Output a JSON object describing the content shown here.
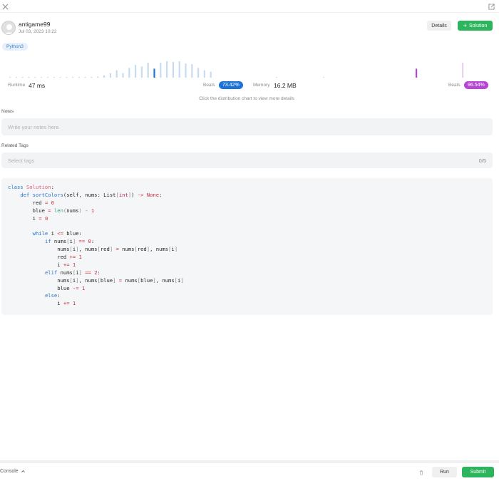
{
  "header": {
    "close_icon": "close-icon",
    "open_external_icon": "open-external-icon"
  },
  "submission": {
    "username": "antigame99",
    "date": "Jul 03, 2023 10:22",
    "details_label": "Details",
    "solution_label": "Solution",
    "language": "Python3"
  },
  "stats": {
    "runtime_label": "Runtime",
    "runtime_value": "47 ms",
    "runtime_beats_label": "Beats",
    "runtime_beats_value": "73.42%",
    "memory_label": "Memory",
    "memory_value": "16.2 MB",
    "memory_beats_label": "Beats",
    "memory_beats_value": "96.54%",
    "hint": "Click the distribution chart to view more details"
  },
  "chart_data": {
    "type": "bar",
    "runtime_distribution": [
      1,
      1,
      1,
      1,
      1,
      1,
      1,
      1,
      1,
      1,
      1,
      1,
      1,
      1,
      1.5,
      3,
      6,
      10,
      6,
      13,
      17,
      15,
      20,
      12,
      20,
      22,
      21,
      22,
      19,
      18,
      13,
      10,
      8
    ],
    "runtime_highlight_index": 23,
    "memory_distribution": [
      1,
      1,
      12,
      20
    ],
    "memory_highlight_index": 2,
    "colors": {
      "runtime_bar": "#c7dcf2",
      "runtime_highlight": "#1d74d6",
      "memory_bar": "#e8d3f3",
      "memory_highlight": "#b646d3"
    }
  },
  "notes": {
    "label": "Notes",
    "placeholder": "Write your notes here"
  },
  "tags": {
    "label": "Related Tags",
    "placeholder": "Select tags",
    "count": "0/5"
  },
  "code": {
    "lines": [
      [
        [
          "kw",
          "class"
        ],
        [
          "t",
          " "
        ],
        [
          "cls",
          "Solution"
        ],
        [
          "t",
          ":"
        ]
      ],
      [
        [
          "t",
          "    "
        ],
        [
          "kw",
          "def"
        ],
        [
          "t",
          " "
        ],
        [
          "fn",
          "sortColors"
        ],
        [
          "t",
          "("
        ],
        [
          "t",
          "self"
        ],
        [
          "t",
          ", nums: "
        ],
        [
          "t",
          "List"
        ],
        [
          "pr",
          "["
        ],
        [
          "ty",
          "int"
        ],
        [
          "pr",
          "]"
        ],
        [
          "t",
          ") "
        ],
        [
          "op",
          "->"
        ],
        [
          "t",
          " "
        ],
        [
          "none",
          "None"
        ],
        [
          "t",
          ":"
        ]
      ],
      [
        [
          "t",
          "        red "
        ],
        [
          "op",
          "="
        ],
        [
          "t",
          " "
        ],
        [
          "num",
          "0"
        ]
      ],
      [
        [
          "t",
          "        blue "
        ],
        [
          "op",
          "="
        ],
        [
          "t",
          " "
        ],
        [
          "bi",
          "len"
        ],
        [
          "pr",
          "("
        ],
        [
          "t",
          "nums"
        ],
        [
          "pr",
          ")"
        ],
        [
          "t",
          " "
        ],
        [
          "op",
          "-"
        ],
        [
          "t",
          " "
        ],
        [
          "num",
          "1"
        ]
      ],
      [
        [
          "t",
          "        i "
        ],
        [
          "op",
          "="
        ],
        [
          "t",
          " "
        ],
        [
          "num",
          "0"
        ]
      ],
      [
        [
          "t",
          ""
        ]
      ],
      [
        [
          "t",
          "        "
        ],
        [
          "kw",
          "while"
        ],
        [
          "t",
          " i "
        ],
        [
          "op",
          "<="
        ],
        [
          "t",
          " blue:"
        ]
      ],
      [
        [
          "t",
          "            "
        ],
        [
          "kw",
          "if"
        ],
        [
          "t",
          " nums"
        ],
        [
          "pr",
          "["
        ],
        [
          "t",
          "i"
        ],
        [
          "pr",
          "]"
        ],
        [
          "t",
          " "
        ],
        [
          "op",
          "=="
        ],
        [
          "t",
          " "
        ],
        [
          "num",
          "0"
        ],
        [
          "t",
          ":"
        ]
      ],
      [
        [
          "t",
          "                nums"
        ],
        [
          "pr",
          "["
        ],
        [
          "t",
          "i"
        ],
        [
          "pr",
          "]"
        ],
        [
          "t",
          ", nums"
        ],
        [
          "pr",
          "["
        ],
        [
          "t",
          "red"
        ],
        [
          "pr",
          "]"
        ],
        [
          "t",
          " "
        ],
        [
          "op",
          "="
        ],
        [
          "t",
          " nums"
        ],
        [
          "pr",
          "["
        ],
        [
          "t",
          "red"
        ],
        [
          "pr",
          "]"
        ],
        [
          "t",
          ", nums"
        ],
        [
          "pr",
          "["
        ],
        [
          "t",
          "i"
        ],
        [
          "pr",
          "]"
        ]
      ],
      [
        [
          "t",
          "                red "
        ],
        [
          "op",
          "+="
        ],
        [
          "t",
          " "
        ],
        [
          "num",
          "1"
        ]
      ],
      [
        [
          "t",
          "                i "
        ],
        [
          "op",
          "+="
        ],
        [
          "t",
          " "
        ],
        [
          "num",
          "1"
        ]
      ],
      [
        [
          "t",
          "            "
        ],
        [
          "kw",
          "elif"
        ],
        [
          "t",
          " nums"
        ],
        [
          "pr",
          "["
        ],
        [
          "t",
          "i"
        ],
        [
          "pr",
          "]"
        ],
        [
          "t",
          " "
        ],
        [
          "op",
          "=="
        ],
        [
          "t",
          " "
        ],
        [
          "num",
          "2"
        ],
        [
          "t",
          ":"
        ]
      ],
      [
        [
          "t",
          "                nums"
        ],
        [
          "pr",
          "["
        ],
        [
          "t",
          "i"
        ],
        [
          "pr",
          "]"
        ],
        [
          "t",
          ", nums"
        ],
        [
          "pr",
          "["
        ],
        [
          "t",
          "blue"
        ],
        [
          "pr",
          "]"
        ],
        [
          "t",
          " "
        ],
        [
          "op",
          "="
        ],
        [
          "t",
          " nums"
        ],
        [
          "pr",
          "["
        ],
        [
          "t",
          "blue"
        ],
        [
          "pr",
          "]"
        ],
        [
          "t",
          ", nums"
        ],
        [
          "pr",
          "["
        ],
        [
          "t",
          "i"
        ],
        [
          "pr",
          "]"
        ]
      ],
      [
        [
          "t",
          "                blue "
        ],
        [
          "op",
          "-="
        ],
        [
          "t",
          " "
        ],
        [
          "num",
          "1"
        ]
      ],
      [
        [
          "t",
          "            "
        ],
        [
          "kw",
          "else"
        ],
        [
          "t",
          ":"
        ]
      ],
      [
        [
          "t",
          "                i "
        ],
        [
          "op",
          "+="
        ],
        [
          "t",
          " "
        ],
        [
          "num",
          "1"
        ]
      ]
    ]
  },
  "console": {
    "label": "Console",
    "run_label": "Run",
    "submit_label": "Submit"
  }
}
